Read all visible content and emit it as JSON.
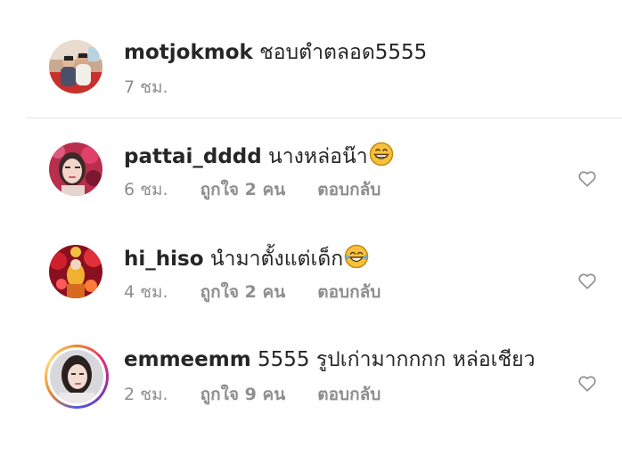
{
  "comments": [
    {
      "username": "motjokmok",
      "text": "ชอบตำตลอด5555",
      "time": "7 ชม.",
      "likes": "",
      "reply": "",
      "emoji": "",
      "story_ring": false,
      "has_heart": false
    },
    {
      "username": "pattai_dddd",
      "text": "นางหล่อน๊า",
      "time": "6 ชม.",
      "likes": "ถูกใจ 2 คน",
      "reply": "ตอบกลับ",
      "emoji": "grinning-face-icon",
      "story_ring": false,
      "has_heart": true
    },
    {
      "username": "hi_hiso",
      "text": "นำมาตั้งแต่เด็ก",
      "time": "4 ชม.",
      "likes": "ถูกใจ 2 คน",
      "reply": "ตอบกลับ",
      "emoji": "tears-of-joy-icon",
      "story_ring": false,
      "has_heart": true
    },
    {
      "username": "emmeemm",
      "text": "5555 รูปเก่ามากกกก หล่อเชียว",
      "time": "2 ชม.",
      "likes": "ถูกใจ 9 คน",
      "reply": "ตอบกลับ",
      "emoji": "",
      "story_ring": true,
      "has_heart": true
    }
  ],
  "colors": {
    "text": "#262626",
    "secondary": "#8e8e8e",
    "divider": "#e4e4e4",
    "emoji_yellow": "#f7c23a"
  }
}
